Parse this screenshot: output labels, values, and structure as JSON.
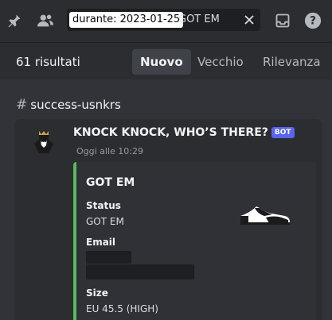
{
  "toolbar": {
    "icons": [
      "pin-icon",
      "members-icon",
      "inbox-icon",
      "help-icon"
    ],
    "search": {
      "filter_chip": "durante: 2023-01-25",
      "query": "GOT EM"
    }
  },
  "results": {
    "count_label": "61 risultati",
    "tabs": [
      {
        "label": "Nuovo",
        "active": true
      },
      {
        "label": "Vecchio",
        "active": false
      },
      {
        "label": "Rilevanza",
        "active": false
      }
    ]
  },
  "channel": {
    "name": "success-usnkrs"
  },
  "message": {
    "author": "KNOCK KNOCK, WHO’S THERE?",
    "badge": "BOT",
    "timestamp": "Oggi alle 10:29",
    "embed": {
      "accent_color": "#5cb85c",
      "title": "GOT EM",
      "fields": [
        {
          "name": "Status",
          "value": "GOT EM"
        },
        {
          "name": "Email",
          "value": ""
        },
        {
          "name": "Size",
          "value": "EU 45.5 (HIGH)"
        }
      ]
    }
  }
}
